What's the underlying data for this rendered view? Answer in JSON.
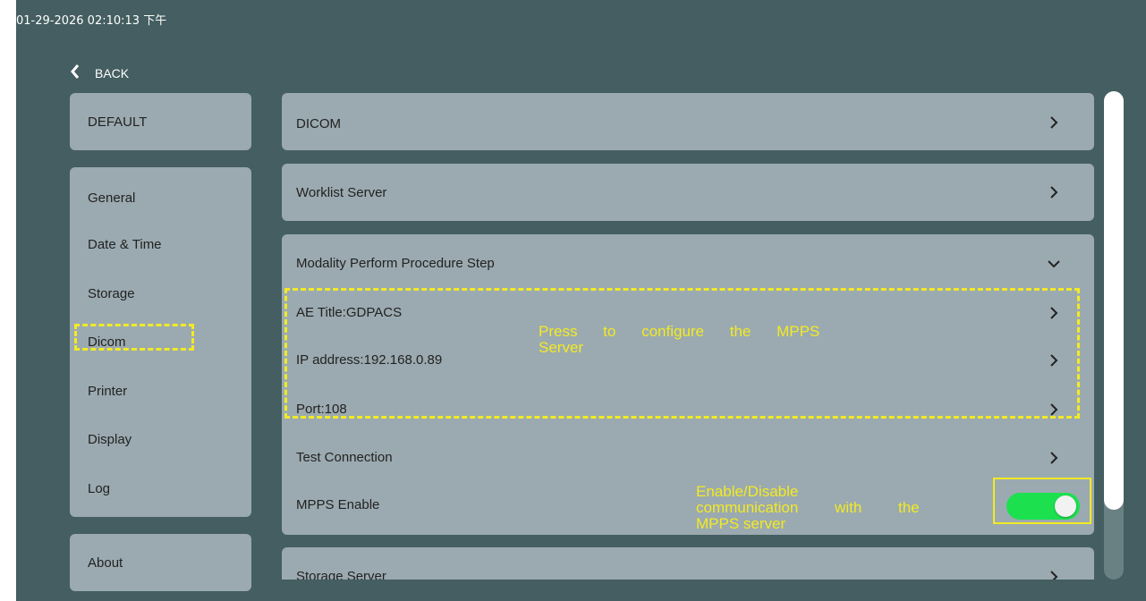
{
  "timestamp": "01-29-2026 02:10:13 下午",
  "back_label": "BACK",
  "sidebar": {
    "default_label": "DEFAULT",
    "items": [
      {
        "label": "General"
      },
      {
        "label": "Date & Time"
      },
      {
        "label": "Storage"
      },
      {
        "label": "Dicom"
      },
      {
        "label": "Printer"
      },
      {
        "label": "Display"
      },
      {
        "label": "Log"
      }
    ],
    "about_label": "About"
  },
  "panels": {
    "dicom": "DICOM",
    "worklist": "Worklist Server",
    "mpps": {
      "title": "Modality Perform Procedure Step",
      "ae_title": "AE Title:GDPACS",
      "ip_address": "IP address:192.168.0.89",
      "port": "Port:108",
      "test_connection": "Test Connection",
      "enable_label": "MPPS Enable",
      "enabled": true
    },
    "storage_server": "Storage Server"
  },
  "annotations": {
    "mpps_config": [
      "Press to configure the MPPS",
      "Server"
    ],
    "mpps_enable": [
      "Enable/Disable",
      "communication with the",
      "MPPS server"
    ]
  },
  "colors": {
    "background": "#445e61",
    "card": "#9baab0",
    "toggle_on": "#1de04f",
    "annotation": "#f3ea23"
  }
}
